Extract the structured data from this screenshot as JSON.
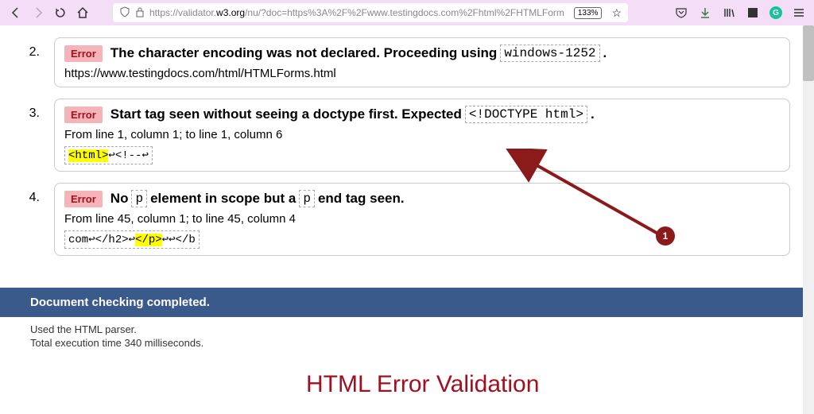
{
  "browser": {
    "url_prefix": "https://validator.",
    "url_dark": "w3.org",
    "url_suffix": "/nu/?doc=https%3A%2F%2Fwww.testingdocs.com%2Fhtml%2FHTMLForm",
    "zoom": "133%"
  },
  "errors": [
    {
      "num": "2.",
      "badge": "Error",
      "msg_parts": [
        "The character encoding was not declared. Proceeding using",
        "windows-1252",
        "."
      ],
      "sub": "https://www.testingdocs.com/html/HTMLForms.html",
      "location": "",
      "snippet_parts": []
    },
    {
      "num": "3.",
      "badge": "Error",
      "msg_parts": [
        "Start tag seen without seeing a doctype first. Expected",
        "<!DOCTYPE html>",
        "."
      ],
      "sub": "",
      "location": "From line 1, column 1; to line 1, column 6",
      "snippet_parts": [
        {
          "text": "<html>",
          "hl": true
        },
        {
          "text": "↩<!--↩",
          "hl": false
        }
      ]
    },
    {
      "num": "4.",
      "badge": "Error",
      "msg_parts": [
        "No",
        "p",
        "element in scope but a",
        "p",
        "end tag seen."
      ],
      "sub": "",
      "location": "From line 45, column 1; to line 45, column 4",
      "snippet_parts": [
        {
          "text": "com↩</h2>↩",
          "hl": false
        },
        {
          "text": "</p>",
          "hl": true
        },
        {
          "text": " ↩↩</b",
          "hl": false
        }
      ]
    }
  ],
  "status": {
    "completed": "Document checking completed.",
    "parser": "Used the HTML parser.",
    "timing": "Total execution time 340 milliseconds."
  },
  "annotation": {
    "badge": "1",
    "title": "HTML Error Validation"
  }
}
